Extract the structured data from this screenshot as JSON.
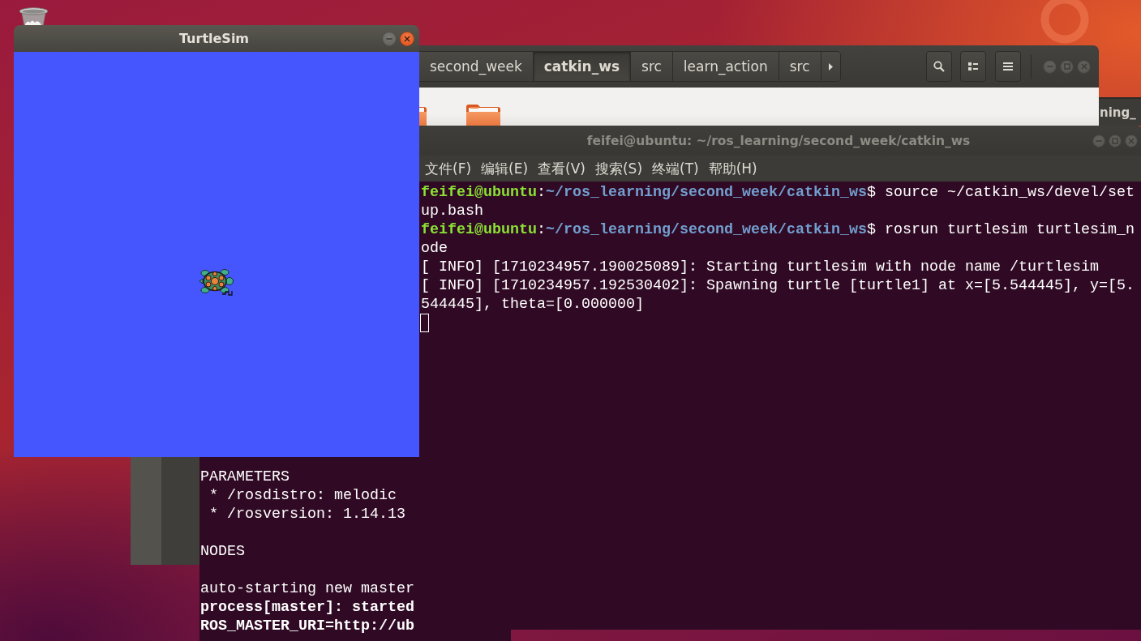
{
  "turtlesim_window": {
    "title": "TurtleSim",
    "focused": true
  },
  "file_manager": {
    "focused": false,
    "path_tabs": [
      {
        "label": "second_week",
        "selected": false
      },
      {
        "label": "catkin_ws",
        "selected": true
      },
      {
        "label": "src",
        "selected": false
      },
      {
        "label": "learn_action",
        "selected": false
      },
      {
        "label": "src",
        "selected": false
      }
    ]
  },
  "background_window": {
    "text": "ning_"
  },
  "terminal": {
    "title": "feifei@ubuntu: ~/ros_learning/second_week/catkin_ws",
    "focused": false,
    "menu": [
      "文件(F)",
      "编辑(E)",
      "查看(V)",
      "搜索(S)",
      "终端(T)",
      "帮助(H)"
    ],
    "lines": [
      {
        "segments": [
          {
            "kind": "user",
            "text": "feifei@ubuntu"
          },
          {
            "kind": "plain",
            "text": ":"
          },
          {
            "kind": "path",
            "text": "~/ros_learning/second_week/catkin_ws"
          },
          {
            "kind": "plain",
            "text": "$ source ~/catkin_ws/devel/setup.bash"
          }
        ]
      },
      {
        "segments": [
          {
            "kind": "user",
            "text": "feifei@ubuntu"
          },
          {
            "kind": "plain",
            "text": ":"
          },
          {
            "kind": "path",
            "text": "~/ros_learning/second_week/catkin_ws"
          },
          {
            "kind": "plain",
            "text": "$ rosrun turtlesim turtlesim_node"
          }
        ]
      },
      {
        "segments": [
          {
            "kind": "plain",
            "text": "[ INFO] [1710234957.190025089]: Starting turtlesim with node name /turtlesim"
          }
        ]
      },
      {
        "segments": [
          {
            "kind": "plain",
            "text": "[ INFO] [1710234957.192530402]: Spawning turtle [turtle1] at x=[5.544445], y=[5.544445], theta=[0.000000]"
          }
        ]
      }
    ]
  },
  "back_terminal": {
    "blocks": [
      {
        "lines": [
          {
            "text": "PARAMETERS",
            "bold": false
          },
          {
            "text": " * /rosdistro: melodic",
            "bold": false
          },
          {
            "text": " * /rosversion: 1.14.13",
            "bold": false
          }
        ]
      },
      {
        "lines": [
          {
            "text": "NODES",
            "bold": false
          }
        ]
      },
      {
        "lines": [
          {
            "text": "auto-starting new master",
            "bold": false
          },
          {
            "text": "process[master]: started",
            "bold": true
          },
          {
            "text": "ROS_MASTER_URI=http://ub",
            "bold": true
          }
        ]
      }
    ]
  }
}
